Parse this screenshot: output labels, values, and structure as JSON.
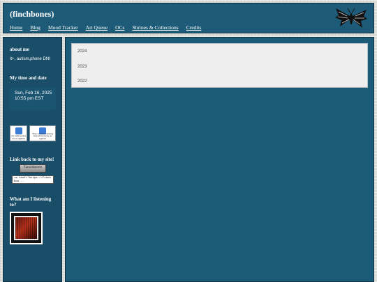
{
  "header": {
    "site_title": "(finchbones)",
    "nav": [
      "Home",
      "Blog",
      "Mood Tracker",
      "Art Queue",
      "OCs",
      "Shrines & Collections",
      "Credits"
    ],
    "logo_icon": "moth-icon"
  },
  "sidebar": {
    "about_heading": "about me",
    "about_text": "it+, autism,phone DNI",
    "time_heading": "My time and date",
    "clock_line1": "Sun, Feb 16, 2025",
    "clock_line2": "10:55 pm EST",
    "stamps": [
      {
        "icon": "computer-icon",
        "text": "me fucking idea ice up against"
      },
      {
        "icon": "computer-icon",
        "text": "'Then turns me fucking idea what pieces up against"
      }
    ],
    "link_heading": "Link back to my site!",
    "link_button_text": "finchbones",
    "link_code": "<a href=\"https://finchbon...",
    "listening_heading": "What am I listening to?"
  },
  "main": {
    "archive_items": [
      "2024",
      "2023",
      "2022"
    ]
  },
  "colors": {
    "panel_blue": "#1c5b78",
    "sidebar_blue": "#1a4e68",
    "archive_bg": "#eeeeee"
  }
}
